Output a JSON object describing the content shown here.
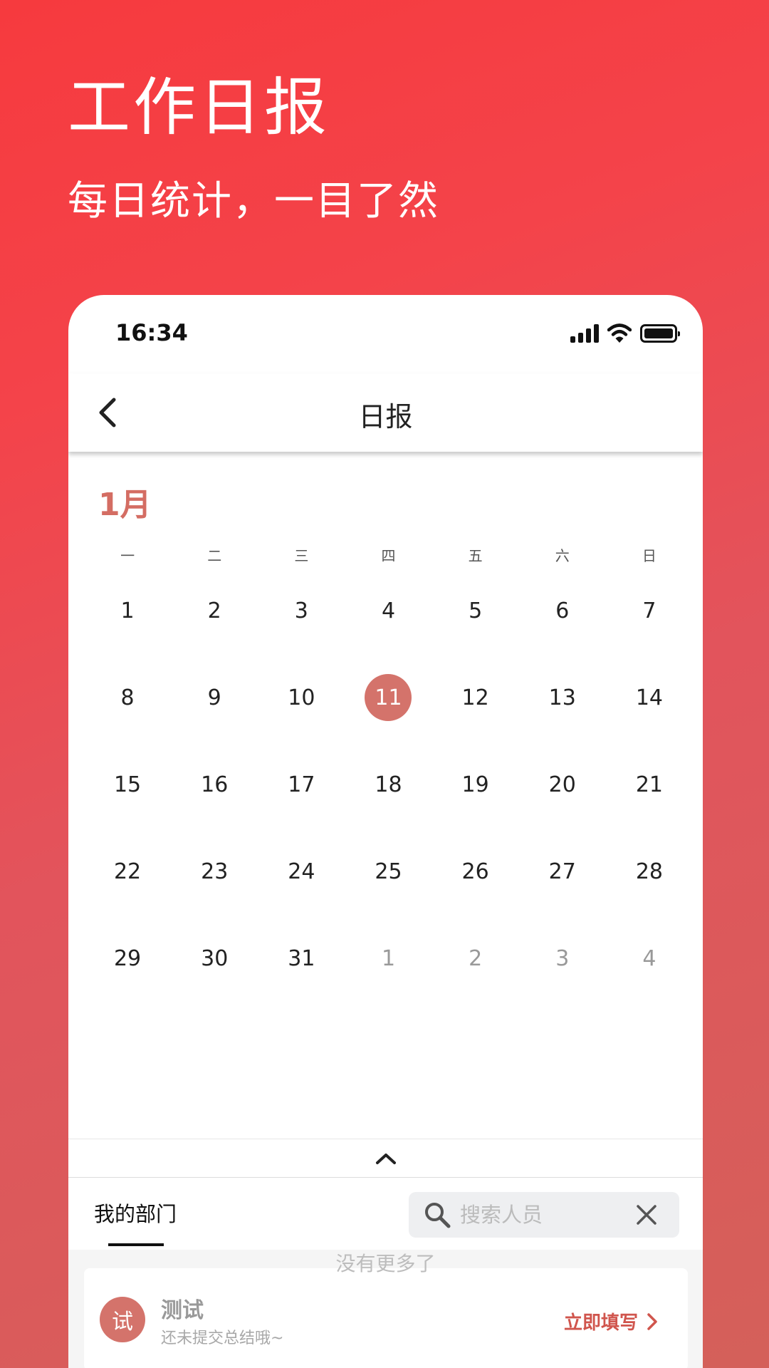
{
  "promo": {
    "title": "工作日报",
    "subtitle": "每日统计，一目了然"
  },
  "status_bar": {
    "time": "16:34",
    "icons": [
      "signal-icon",
      "wifi-icon",
      "battery-icon"
    ]
  },
  "navbar": {
    "back_icon": "chevron-left-icon",
    "title": "日报"
  },
  "calendar": {
    "month": "1月",
    "weekdays": [
      "一",
      "二",
      "三",
      "四",
      "五",
      "六",
      "日"
    ],
    "selected_day": "11",
    "days": [
      {
        "label": "1",
        "other": false
      },
      {
        "label": "2",
        "other": false
      },
      {
        "label": "3",
        "other": false
      },
      {
        "label": "4",
        "other": false
      },
      {
        "label": "5",
        "other": false
      },
      {
        "label": "6",
        "other": false
      },
      {
        "label": "7",
        "other": false
      },
      {
        "label": "8",
        "other": false
      },
      {
        "label": "9",
        "other": false
      },
      {
        "label": "10",
        "other": false
      },
      {
        "label": "11",
        "other": false
      },
      {
        "label": "12",
        "other": false
      },
      {
        "label": "13",
        "other": false
      },
      {
        "label": "14",
        "other": false
      },
      {
        "label": "15",
        "other": false
      },
      {
        "label": "16",
        "other": false
      },
      {
        "label": "17",
        "other": false
      },
      {
        "label": "18",
        "other": false
      },
      {
        "label": "19",
        "other": false
      },
      {
        "label": "20",
        "other": false
      },
      {
        "label": "21",
        "other": false
      },
      {
        "label": "22",
        "other": false
      },
      {
        "label": "23",
        "other": false
      },
      {
        "label": "24",
        "other": false
      },
      {
        "label": "25",
        "other": false
      },
      {
        "label": "26",
        "other": false
      },
      {
        "label": "27",
        "other": false
      },
      {
        "label": "28",
        "other": false
      },
      {
        "label": "29",
        "other": false
      },
      {
        "label": "30",
        "other": false
      },
      {
        "label": "31",
        "other": false
      },
      {
        "label": "1",
        "other": true
      },
      {
        "label": "2",
        "other": true
      },
      {
        "label": "3",
        "other": true
      },
      {
        "label": "4",
        "other": true
      }
    ],
    "collapse_icon": "chevron-up-icon"
  },
  "tabs": {
    "dept_label": "我的部门",
    "search_placeholder": "搜索人员",
    "search_icon": "search-icon",
    "clear_icon": "close-icon"
  },
  "list": {
    "items": [
      {
        "avatar_text": "试",
        "name": "测试",
        "subtitle": "还未提交总结哦~",
        "action_label": "立即填写"
      }
    ],
    "footer": "没有更多了"
  },
  "colors": {
    "accent": "#d4736b",
    "action_text": "#d0554d",
    "background_gradient_start": "#f63a3e",
    "background_gradient_end": "#d4605a"
  }
}
